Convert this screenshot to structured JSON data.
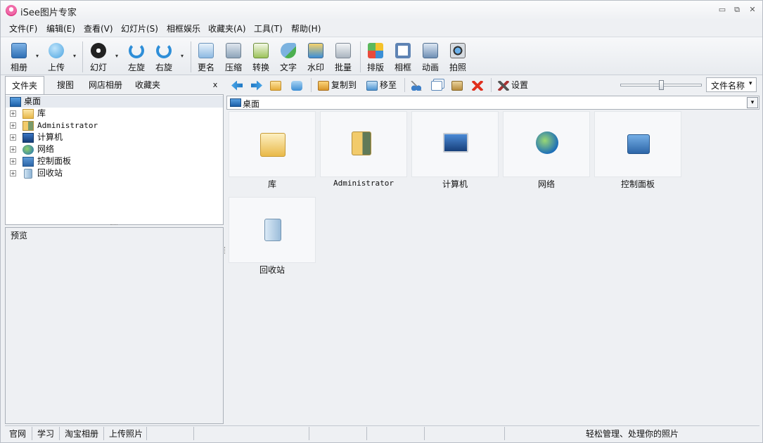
{
  "app": {
    "title": "iSee图片专家"
  },
  "window_controls": {
    "minimize": "▭",
    "restore": "⧉",
    "close": "✕"
  },
  "menu": [
    "文件(F)",
    "编辑(E)",
    "查看(V)",
    "幻灯片(S)",
    "相框娱乐",
    "收藏夹(A)",
    "工具(T)",
    "帮助(H)"
  ],
  "toolbar": {
    "items": [
      "相册",
      "上传",
      "幻灯",
      "左旋",
      "右旋",
      "更名",
      "压缩",
      "转换",
      "文字",
      "水印",
      "批量",
      "排版",
      "相框",
      "动画",
      "拍照"
    ],
    "dropdown_glyph": "▾"
  },
  "left_tabs": {
    "items": [
      "文件夹",
      "搜图",
      "网店相册",
      "收藏夹"
    ],
    "close": "x"
  },
  "tree": {
    "root": "桌面",
    "children": [
      "库",
      "Administrator",
      "计算机",
      "网络",
      "控制面板",
      "回收站"
    ],
    "expander": "+"
  },
  "preview": {
    "label": "预览"
  },
  "content_toolbar": {
    "copy_to": "复制到",
    "move_to": "移至",
    "settings": "设置",
    "sort": "文件名称",
    "sort_arrow": "▾",
    "zoom_value": 0.5
  },
  "address": {
    "path": "桌面",
    "arrow": "▾"
  },
  "thumbnails": [
    "库",
    "Administrator",
    "计算机",
    "网络",
    "控制面板",
    "回收站"
  ],
  "status": {
    "items": [
      "官网",
      "学习",
      "淘宝相册",
      "上传照片"
    ],
    "message": "轻松管理、处理你的照片"
  },
  "colors": {
    "accent": "#3a8fd6",
    "panel_bg": "#eef0f3",
    "thumb_bg": "#f7f8fa"
  }
}
